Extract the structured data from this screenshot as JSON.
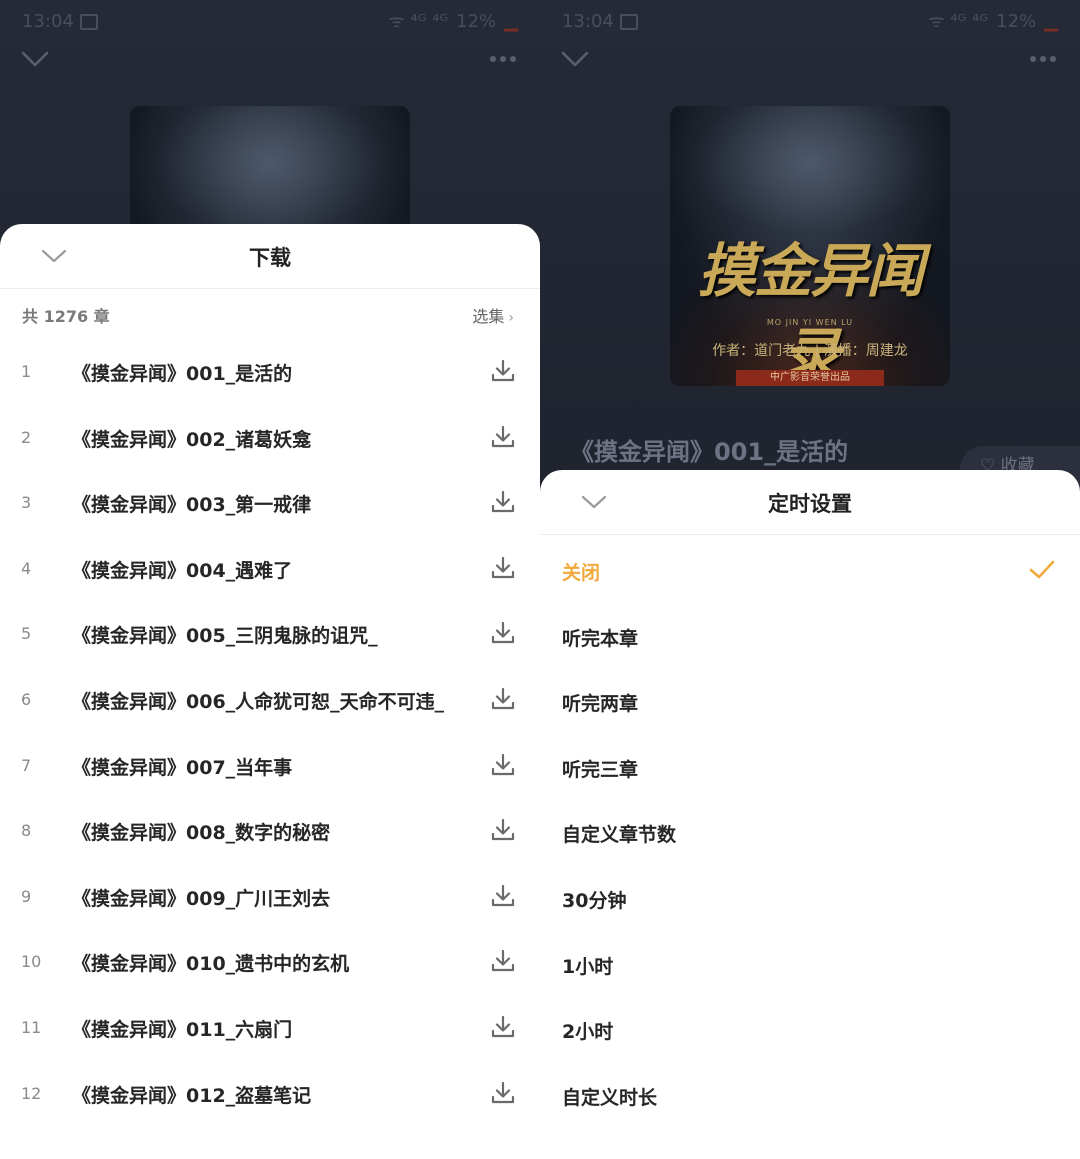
{
  "status_bar": {
    "time": "13:04",
    "signal_text": "ᯤ ⁴ᴳ ⁴ᴳ",
    "battery": "12%"
  },
  "left": {
    "download_sheet": {
      "title": "下载",
      "chapter_count": "共 1276 章",
      "select_label": "选集",
      "chapters": [
        {
          "num": "1",
          "title": "《摸金异闻》001_是活的"
        },
        {
          "num": "2",
          "title": "《摸金异闻》002_诸葛妖龛"
        },
        {
          "num": "3",
          "title": "《摸金异闻》003_第一戒律"
        },
        {
          "num": "4",
          "title": "《摸金异闻》004_遇难了"
        },
        {
          "num": "5",
          "title": "《摸金异闻》005_三阴鬼脉的诅咒_"
        },
        {
          "num": "6",
          "title": "《摸金异闻》006_人命犹可恕_天命不可违_"
        },
        {
          "num": "7",
          "title": "《摸金异闻》007_当年事"
        },
        {
          "num": "8",
          "title": "《摸金异闻》008_数字的秘密"
        },
        {
          "num": "9",
          "title": "《摸金异闻》009_广川王刘去"
        },
        {
          "num": "10",
          "title": "《摸金异闻》010_遗书中的玄机"
        },
        {
          "num": "11",
          "title": "《摸金异闻》011_六扇门"
        },
        {
          "num": "12",
          "title": "《摸金异闻》012_盗墓笔记"
        }
      ]
    }
  },
  "right": {
    "cover": {
      "title_art": "摸金异闻录",
      "pinyin": "MO JIN YI WEN LU",
      "credits": "作者：道门老九 | 演播：周建龙",
      "studio": "中广影音荣誉出品"
    },
    "now_playing_title": "《摸金异闻》001_是活的",
    "favorite_label": "收藏",
    "timer_sheet": {
      "title": "定时设置",
      "options": [
        {
          "label": "关闭",
          "selected": true
        },
        {
          "label": "听完本章",
          "selected": false
        },
        {
          "label": "听完两章",
          "selected": false
        },
        {
          "label": "听完三章",
          "selected": false
        },
        {
          "label": "自定义章节数",
          "selected": false
        },
        {
          "label": "30分钟",
          "selected": false
        },
        {
          "label": "1小时",
          "selected": false
        },
        {
          "label": "2小时",
          "selected": false
        },
        {
          "label": "自定义时长",
          "selected": false
        }
      ]
    }
  },
  "colors": {
    "accent": "#f2a93b",
    "sheet_bg": "#ffffff",
    "backdrop": "#1f232e"
  }
}
